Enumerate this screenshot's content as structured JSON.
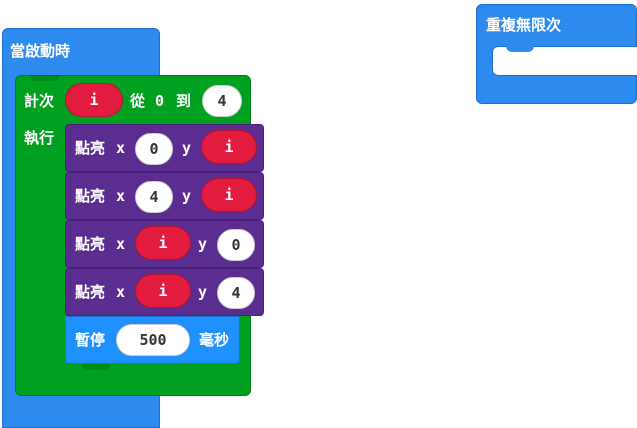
{
  "workspace": {
    "colors": {
      "event": "#2d8bf0",
      "loop": "#00a020",
      "led": "#5c2d91",
      "pause": "#1e90ff",
      "variable": "#e31b3e",
      "number": "#ffffff"
    }
  },
  "on_start": {
    "label": "當啟動時",
    "for_loop": {
      "label_count": "計次",
      "variable": "i",
      "label_from": "從",
      "from_value": "0",
      "label_to": "到",
      "to_value": "4",
      "label_do": "執行",
      "plots": [
        {
          "label": "點亮",
          "x_label": "x",
          "x": "0",
          "x_is_var": false,
          "y_label": "y",
          "y": "i",
          "y_is_var": true
        },
        {
          "label": "點亮",
          "x_label": "x",
          "x": "4",
          "x_is_var": false,
          "y_label": "y",
          "y": "i",
          "y_is_var": true
        },
        {
          "label": "點亮",
          "x_label": "x",
          "x": "i",
          "x_is_var": true,
          "y_label": "y",
          "y": "0",
          "y_is_var": false
        },
        {
          "label": "點亮",
          "x_label": "x",
          "x": "i",
          "x_is_var": true,
          "y_label": "y",
          "y": "4",
          "y_is_var": false
        }
      ],
      "pause": {
        "label": "暫停",
        "value": "500",
        "unit": "毫秒"
      }
    }
  },
  "forever": {
    "label": "重複無限次"
  }
}
